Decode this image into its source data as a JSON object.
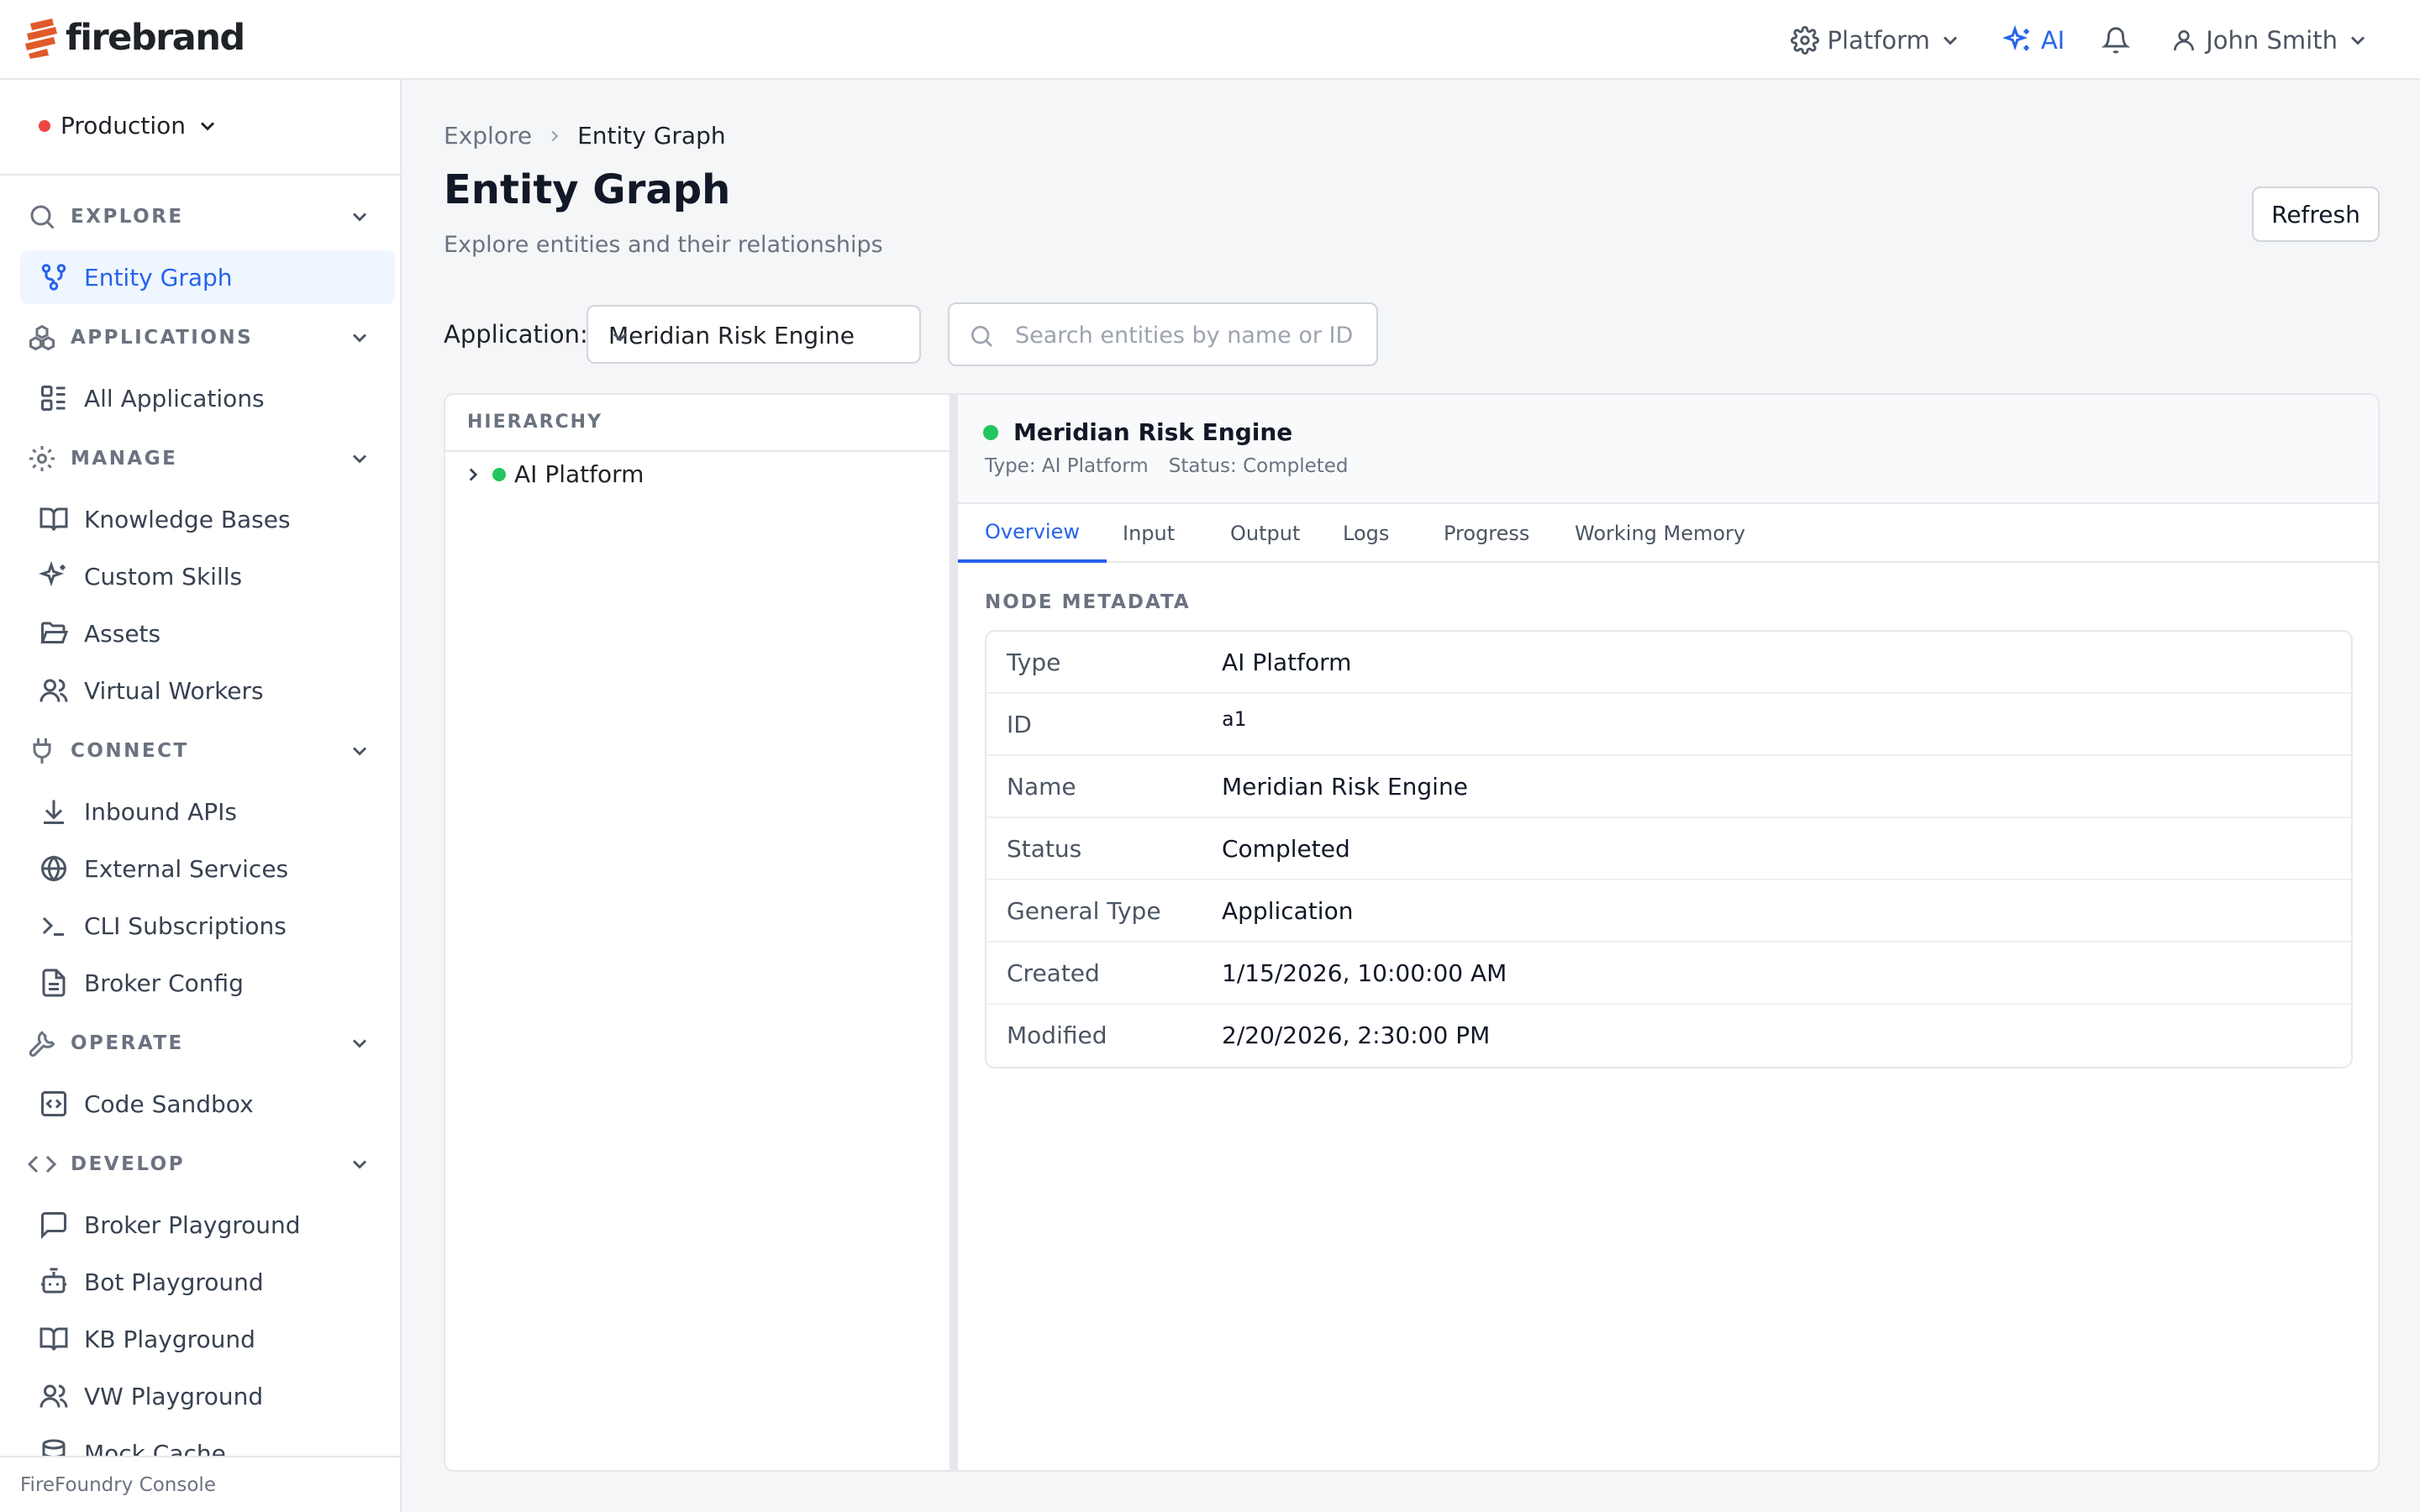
{
  "brand": {
    "name": "firebrand"
  },
  "topbar": {
    "platform_label": "Platform",
    "ai_label": "AI",
    "user_name": "John Smith"
  },
  "sidebar": {
    "environment": "Production",
    "sections": [
      {
        "label": "EXPLORE",
        "items": [
          {
            "label": "Entity Graph",
            "active": true
          }
        ]
      },
      {
        "label": "APPLICATIONS",
        "items": [
          {
            "label": "All Applications"
          }
        ]
      },
      {
        "label": "MANAGE",
        "items": [
          {
            "label": "Knowledge Bases"
          },
          {
            "label": "Custom Skills"
          },
          {
            "label": "Assets"
          },
          {
            "label": "Virtual Workers"
          }
        ]
      },
      {
        "label": "CONNECT",
        "items": [
          {
            "label": "Inbound APIs"
          },
          {
            "label": "External Services"
          },
          {
            "label": "CLI Subscriptions"
          },
          {
            "label": "Broker Config"
          }
        ]
      },
      {
        "label": "OPERATE",
        "items": [
          {
            "label": "Code Sandbox"
          }
        ]
      },
      {
        "label": "DEVELOP",
        "items": [
          {
            "label": "Broker Playground"
          },
          {
            "label": "Bot Playground"
          },
          {
            "label": "KB Playground"
          },
          {
            "label": "VW Playground"
          },
          {
            "label": "Mock Cache"
          }
        ]
      }
    ],
    "footer": "FireFoundry Console"
  },
  "breadcrumb": {
    "parent": "Explore",
    "current": "Entity Graph"
  },
  "page": {
    "title": "Entity Graph",
    "subtitle": "Explore entities and their relationships",
    "refresh_label": "Refresh"
  },
  "filters": {
    "application_label": "Application:",
    "application_value": "Meridian Risk Engine",
    "search_placeholder": "Search entities by name or ID"
  },
  "hierarchy": {
    "heading": "HIERARCHY",
    "root": {
      "label": "AI Platform",
      "status_color": "#22c55e"
    }
  },
  "entity": {
    "name": "Meridian Risk Engine",
    "type_text": "Type: AI Platform",
    "status_text": "Status: Completed",
    "status_color": "#22c55e",
    "tabs": [
      "Overview",
      "Input",
      "Output",
      "Logs",
      "Progress",
      "Working Memory"
    ],
    "active_tab": "Overview",
    "metadata_heading": "NODE METADATA",
    "metadata": [
      {
        "key": "Type",
        "value": "AI Platform"
      },
      {
        "key": "ID",
        "value": "a1"
      },
      {
        "key": "Name",
        "value": "Meridian Risk Engine"
      },
      {
        "key": "Status",
        "value": "Completed"
      },
      {
        "key": "General Type",
        "value": "Application"
      },
      {
        "key": "Created",
        "value": "1/15/2026, 10:00:00 AM"
      },
      {
        "key": "Modified",
        "value": "2/20/2026, 2:30:00 PM"
      }
    ]
  },
  "colors": {
    "accent": "#2563eb",
    "brand": "#e05a2b",
    "env_status": "#ef4444"
  }
}
